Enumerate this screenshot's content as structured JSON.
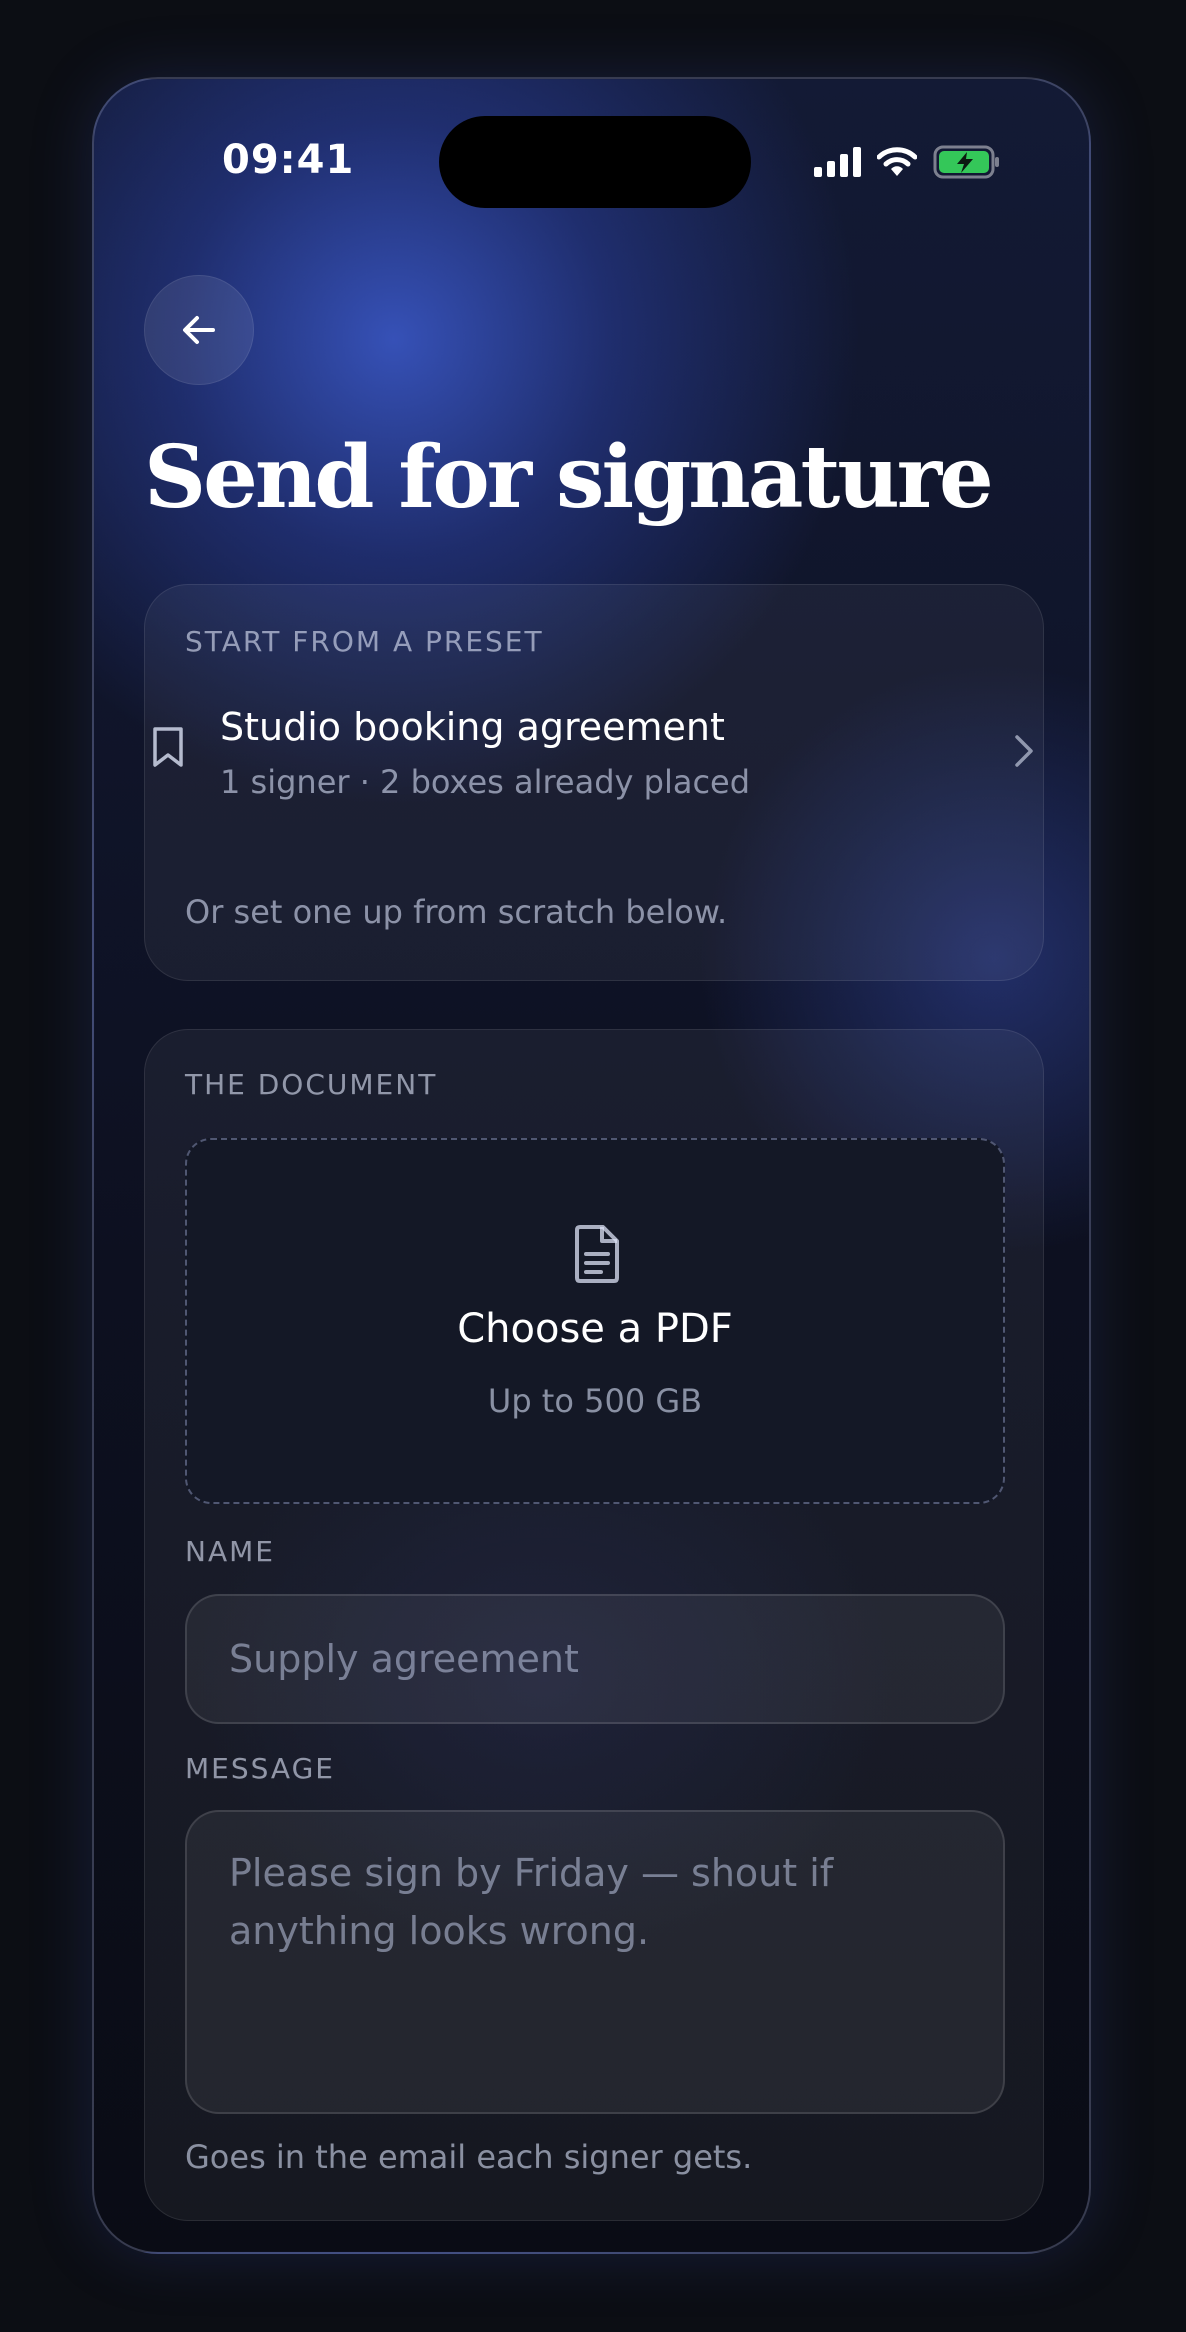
{
  "status_bar": {
    "time": "09:41"
  },
  "header": {
    "title": "Send for signature"
  },
  "preset": {
    "section_label": "START FROM A PRESET",
    "name": "Studio booking agreement",
    "meta": "1 signer · 2 boxes already placed",
    "hint": "Or set one up from scratch below."
  },
  "document": {
    "section_label": "THE DOCUMENT",
    "upload_title": "Choose a PDF",
    "upload_limit": "Up to 500 GB",
    "name_label": "NAME",
    "name_placeholder": "Supply agreement",
    "message_label": "MESSAGE",
    "message_placeholder": "Please sign by Friday — shout if anything looks wrong.",
    "message_hint": "Goes in the email each signer gets."
  },
  "icons": {
    "back": "arrow-left-icon",
    "preset": "bookmark-icon",
    "open": "chevron-right-icon",
    "upload": "document-icon"
  },
  "colors": {
    "battery_fill": "#34c759",
    "accent_glow": "#3854be"
  }
}
